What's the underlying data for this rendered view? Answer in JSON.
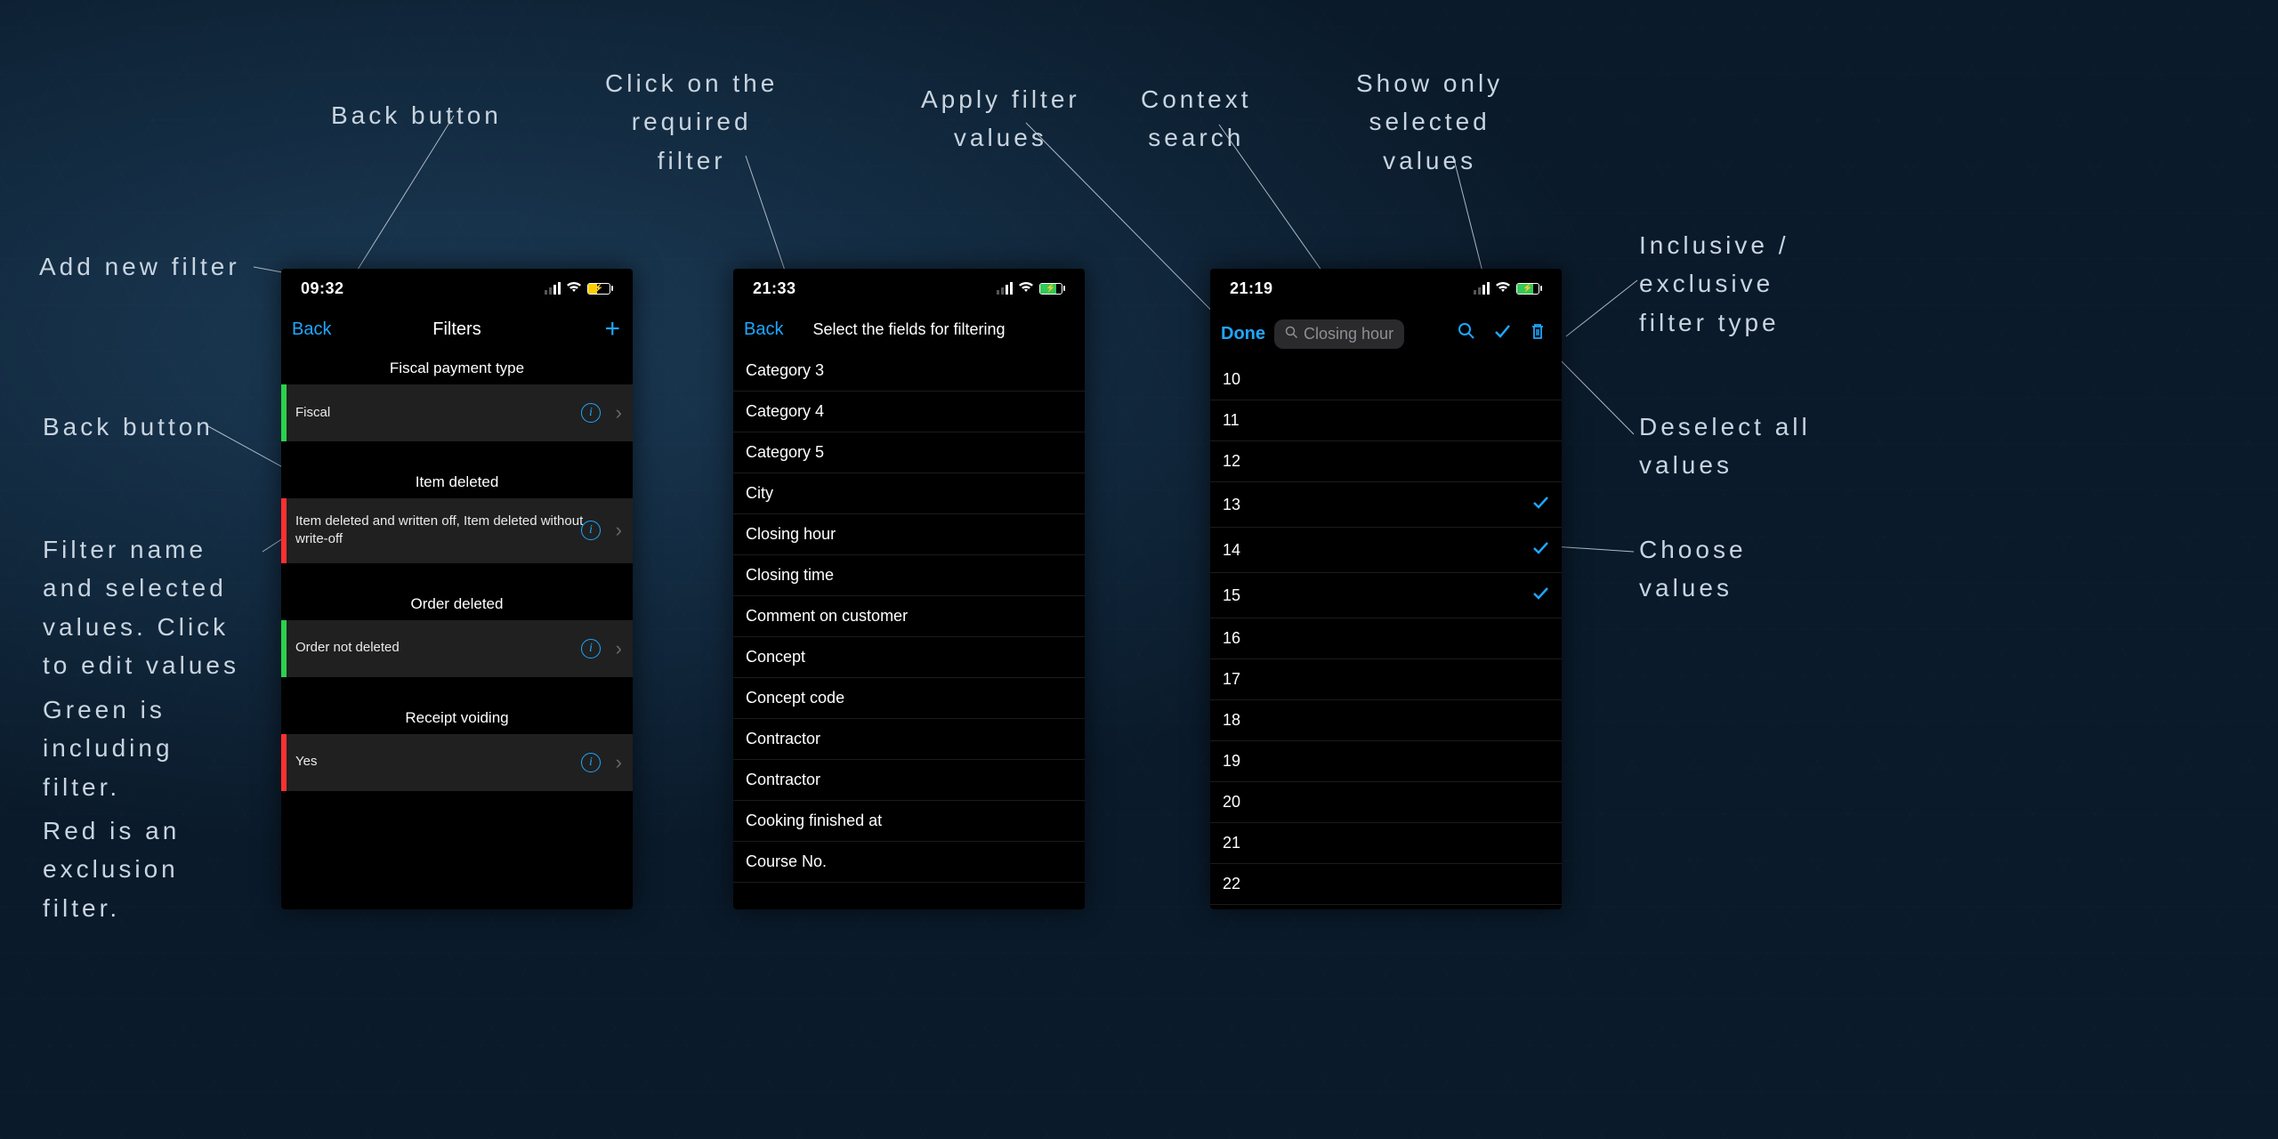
{
  "accent": "#1ea7ff",
  "stripe_green": "#2bd14b",
  "stripe_red": "#ff3030",
  "annotations": {
    "add_new_filter": "Add new filter",
    "back_button_top": "Back button",
    "filter_name_desc": "Filter name\nand selected\nvalues. Click\nto edit values",
    "green_desc": "Green is\nincluding\nfilter.",
    "red_desc": "Red is an\nexclusion\nfilter.",
    "back_button_left": "Back button",
    "click_required_filter": "Click on the\nrequired\nfilter",
    "apply_filter_values": "Apply filter\nvalues",
    "context_search": "Context\nsearch",
    "show_only_selected": "Show only\nselected\nvalues",
    "inclusive_exclusive": "Inclusive /\nexclusive\nfilter type",
    "deselect_all": "Deselect all\nvalues",
    "choose_values": "Choose\nvalues",
    "back_button_mid": "Back button"
  },
  "screen1": {
    "statusbar_time": "09:32",
    "back_label": "Back",
    "title": "Filters",
    "sections": [
      {
        "header": "Fiscal payment type",
        "value": "Fiscal",
        "stripe": "green"
      },
      {
        "header": "Item deleted",
        "value": "Item deleted and written off, Item deleted without write-off",
        "stripe": "red"
      },
      {
        "header": "Order deleted",
        "value": "Order not deleted",
        "stripe": "green"
      },
      {
        "header": "Receipt voiding",
        "value": "Yes",
        "stripe": "red"
      }
    ]
  },
  "screen2": {
    "statusbar_time": "21:33",
    "back_label": "Back",
    "title": "Select the fields for filtering",
    "fields": [
      "Category 3",
      "Category 4",
      "Category 5",
      "City",
      "Closing hour",
      "Closing time",
      "Comment on customer",
      "Concept",
      "Concept code",
      "Contractor",
      "Contractor",
      "Cooking finished at",
      "Course No."
    ]
  },
  "screen3": {
    "statusbar_time": "21:19",
    "done_label": "Done",
    "search_placeholder": "Closing hour",
    "values": [
      {
        "v": "10",
        "checked": false
      },
      {
        "v": "11",
        "checked": false
      },
      {
        "v": "12",
        "checked": false
      },
      {
        "v": "13",
        "checked": true
      },
      {
        "v": "14",
        "checked": true
      },
      {
        "v": "15",
        "checked": true
      },
      {
        "v": "16",
        "checked": false
      },
      {
        "v": "17",
        "checked": false
      },
      {
        "v": "18",
        "checked": false
      },
      {
        "v": "19",
        "checked": false
      },
      {
        "v": "20",
        "checked": false
      },
      {
        "v": "21",
        "checked": false
      },
      {
        "v": "22",
        "checked": false
      }
    ]
  }
}
